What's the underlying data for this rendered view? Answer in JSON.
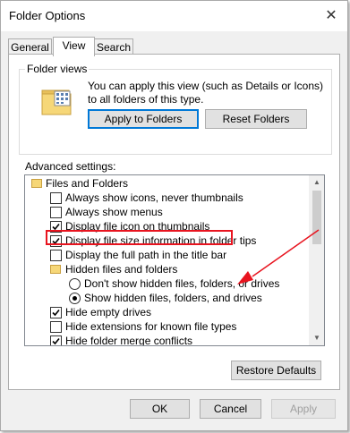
{
  "window": {
    "title": "Folder Options",
    "close_glyph": "✕"
  },
  "tabs": [
    {
      "label": "General",
      "active": false
    },
    {
      "label": "View",
      "active": true
    },
    {
      "label": "Search",
      "active": false
    }
  ],
  "folder_views": {
    "legend": "Folder views",
    "icon": "folder-icon",
    "description": "You can apply this view (such as Details or Icons) to all folders of this type.",
    "apply_button": "Apply to Folders",
    "reset_button": "Reset Folders"
  },
  "advanced": {
    "label": "Advanced settings:",
    "items": [
      {
        "type": "folder",
        "label": "Files and Folders"
      },
      {
        "type": "checkbox",
        "checked": false,
        "label": "Always show icons, never thumbnails"
      },
      {
        "type": "checkbox",
        "checked": false,
        "label": "Always show menus"
      },
      {
        "type": "checkbox",
        "checked": true,
        "label": "Display file icon on thumbnails"
      },
      {
        "type": "checkbox",
        "checked": true,
        "label": "Display file size information in folder tips"
      },
      {
        "type": "checkbox",
        "checked": false,
        "label": "Display the full path in the title bar"
      },
      {
        "type": "folder",
        "label": "Hidden files and folders"
      },
      {
        "type": "radio",
        "checked": false,
        "label": "Don't show hidden files, folders, or drives"
      },
      {
        "type": "radio",
        "checked": true,
        "label": "Show hidden files, folders, and drives"
      },
      {
        "type": "checkbox",
        "checked": true,
        "label": "Hide empty drives"
      },
      {
        "type": "checkbox",
        "checked": false,
        "label": "Hide extensions for known file types"
      },
      {
        "type": "checkbox",
        "checked": true,
        "label": "Hide folder merge conflicts"
      }
    ]
  },
  "restore_button": "Restore Defaults",
  "footer": {
    "ok": "OK",
    "cancel": "Cancel",
    "apply": "Apply"
  },
  "colors": {
    "annotation": "#e8141f",
    "focus": "#0078d7"
  }
}
